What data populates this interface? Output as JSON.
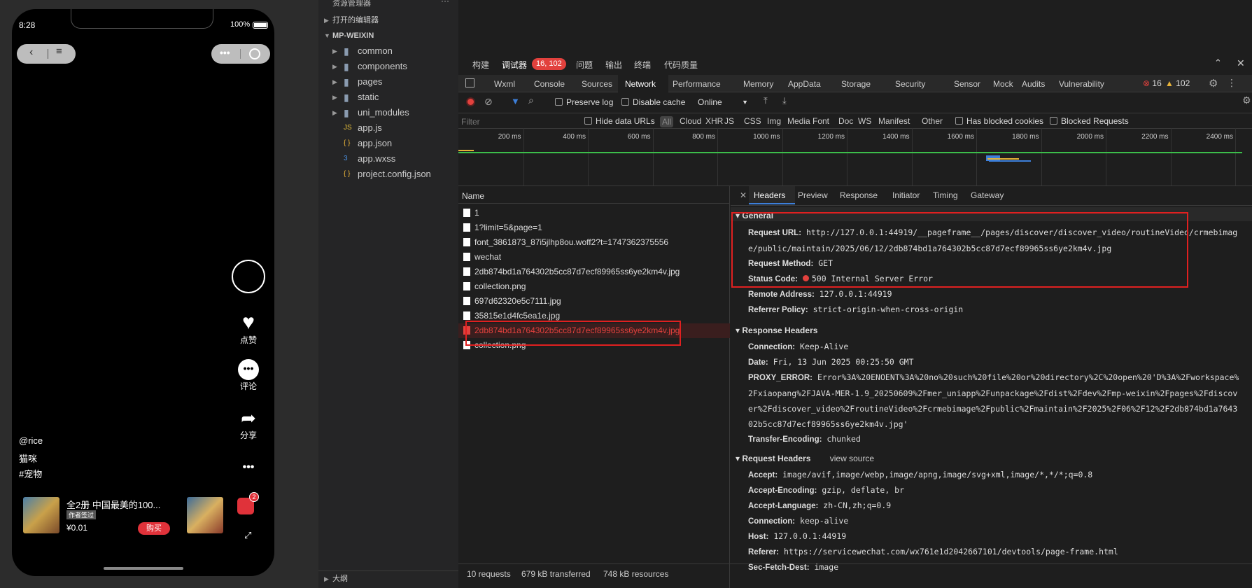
{
  "phone": {
    "time": "8:28",
    "battery": "100%",
    "username": "@rice",
    "caption": "猫咪",
    "hashtag": "#宠物",
    "like_label": "点赞",
    "comment_label": "评论",
    "share_label": "分享",
    "product_title": "全2册 中国最美的100...",
    "product_tag": "作者签过",
    "product_price": "¥0.01",
    "buy_label": "购买",
    "cart_badge": "2"
  },
  "explorer": {
    "header": "资源管理器",
    "open_editors": "打开的编辑器",
    "project": "MP-WEIXIN",
    "items": [
      {
        "label": "common",
        "type": "folder"
      },
      {
        "label": "components",
        "type": "folder"
      },
      {
        "label": "pages",
        "type": "folder"
      },
      {
        "label": "static",
        "type": "folder"
      },
      {
        "label": "uni_modules",
        "type": "folder"
      },
      {
        "label": "app.js",
        "type": "js"
      },
      {
        "label": "app.json",
        "type": "json"
      },
      {
        "label": "app.wxss",
        "type": "css"
      },
      {
        "label": "project.config.json",
        "type": "json"
      }
    ],
    "outline": "大纲"
  },
  "devtools": {
    "top_tabs": [
      "构建",
      "调试器",
      "问题",
      "输出",
      "终端",
      "代码质量"
    ],
    "badge": "16, 102",
    "panel_tabs": [
      "Wxml",
      "Console",
      "Sources",
      "Network",
      "Performance",
      "Memory",
      "AppData",
      "Storage",
      "Security",
      "Sensor",
      "Mock",
      "Audits",
      "Vulnerability"
    ],
    "errors": "16",
    "warnings": "102",
    "preserve_log": "Preserve log",
    "disable_cache": "Disable cache",
    "throttle": "Online",
    "filter_placeholder": "Filter",
    "hide_data_urls": "Hide data URLs",
    "types": [
      "All",
      "Cloud",
      "XHR",
      "JS",
      "CSS",
      "Img",
      "Media",
      "Font",
      "Doc",
      "WS",
      "Manifest",
      "Other"
    ],
    "has_blocked": "Has blocked cookies",
    "blocked_requests": "Blocked Requests",
    "timeline_ticks": [
      "200 ms",
      "400 ms",
      "600 ms",
      "800 ms",
      "1000 ms",
      "1200 ms",
      "1400 ms",
      "1600 ms",
      "1800 ms",
      "2000 ms",
      "2200 ms",
      "2400 ms"
    ],
    "name_header": "Name",
    "requests": [
      {
        "name": "1",
        "error": false
      },
      {
        "name": "1?limit=5&page=1",
        "error": false
      },
      {
        "name": "font_3861873_87i5jlhp8ou.woff2?t=1747362375556",
        "error": false
      },
      {
        "name": "wechat",
        "error": false
      },
      {
        "name": "2db874bd1a764302b5cc87d7ecf89965ss6ye2km4v.jpg",
        "error": false
      },
      {
        "name": "collection.png",
        "error": false
      },
      {
        "name": "697d62320e5c7111.jpg",
        "error": false
      },
      {
        "name": "35815e1d4fc5ea1e.jpg",
        "error": false
      },
      {
        "name": "2db874bd1a764302b5cc87d7ecf89965ss6ye2km4v.jpg",
        "error": true
      },
      {
        "name": "collection.png",
        "error": false
      }
    ],
    "status_bar": {
      "requests": "10 requests",
      "transferred": "679 kB transferred",
      "resources": "748 kB resources"
    },
    "detail_tabs": [
      "Headers",
      "Preview",
      "Response",
      "Initiator",
      "Timing",
      "Gateway"
    ],
    "general_title": "General",
    "general": [
      {
        "key": "Request URL:",
        "value": "http://127.0.0.1:44919/__pageframe__/pages/discover/discover_video/routineVideo/crmebimage/public/maintain/2025/06/12/2db874bd1a764302b5cc87d7ecf89965ss6ye2km4v.jpg"
      },
      {
        "key": "Request Method:",
        "value": "GET"
      },
      {
        "key": "Status Code:",
        "value": "500 Internal Server Error"
      },
      {
        "key": "Remote Address:",
        "value": "127.0.0.1:44919"
      },
      {
        "key": "Referrer Policy:",
        "value": "strict-origin-when-cross-origin"
      }
    ],
    "response_title": "Response Headers",
    "response": [
      {
        "key": "Connection:",
        "value": "Keep-Alive"
      },
      {
        "key": "Date:",
        "value": "Fri, 13 Jun 2025 00:25:50 GMT"
      },
      {
        "key": "PROXY_ERROR:",
        "value": "Error%3A%20ENOENT%3A%20no%20such%20file%20or%20directory%2C%20open%20'D%3A%2Fworkspace%2Fxiaopang%2FJAVA-MER-1.9_20250609%2Fmer_uniapp%2Funpackage%2Fdist%2Fdev%2Fmp-weixin%2Fpages%2Fdiscover%2Fdiscover_video%2FroutineVideo%2Fcrmebimage%2Fpublic%2Fmaintain%2F2025%2F06%2F12%2F2db874bd1a764302b5cc87d7ecf89965ss6ye2km4v.jpg'"
      },
      {
        "key": "Transfer-Encoding:",
        "value": "chunked"
      }
    ],
    "request_title": "Request Headers",
    "view_source": "view source",
    "request": [
      {
        "key": "Accept:",
        "value": "image/avif,image/webp,image/apng,image/svg+xml,image/*,*/*;q=0.8"
      },
      {
        "key": "Accept-Encoding:",
        "value": "gzip, deflate, br"
      },
      {
        "key": "Accept-Language:",
        "value": "zh-CN,zh;q=0.9"
      },
      {
        "key": "Connection:",
        "value": "keep-alive"
      },
      {
        "key": "Host:",
        "value": "127.0.0.1:44919"
      },
      {
        "key": "Referer:",
        "value": "https://servicewechat.com/wx761e1d2042667101/devtools/page-frame.html"
      },
      {
        "key": "Sec-Fetch-Dest:",
        "value": "image"
      }
    ],
    "colors": {
      "error": "#e2413d",
      "highlight": "#e02020",
      "accent": "#3d7fd9"
    }
  }
}
